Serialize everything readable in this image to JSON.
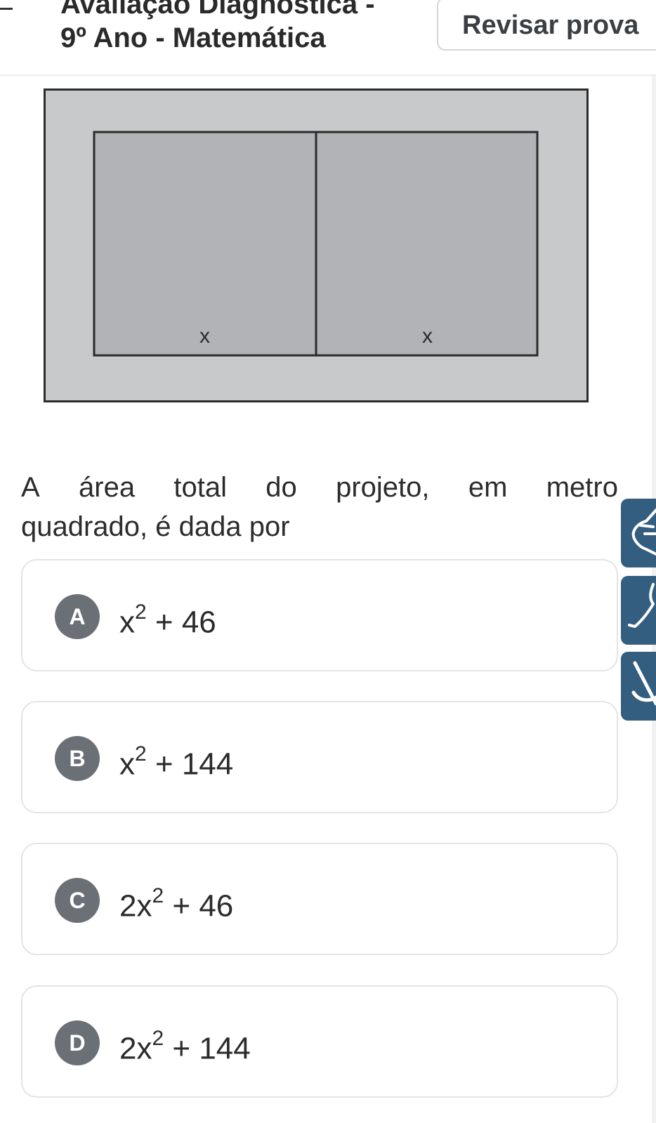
{
  "header": {
    "title_line1": "Avaliação Diagnóstica -",
    "title_line2": "9º Ano - Matemática",
    "review_label": "Revisar prova"
  },
  "figure": {
    "label_left": "x",
    "label_right": "x",
    "colors": {
      "outer": "#c8c9cb",
      "inner": "#b2b3b6",
      "stroke": "#2b2b2b"
    }
  },
  "question": {
    "line1_words": [
      "A",
      "área",
      "total",
      "do",
      "projeto,",
      "em",
      "metro"
    ],
    "line2": "quadrado, é dada por"
  },
  "options": [
    {
      "letter": "A",
      "coef": "",
      "var": "x",
      "exp": "2",
      "rest": " + 46"
    },
    {
      "letter": "B",
      "coef": "",
      "var": "x",
      "exp": "2",
      "rest": " + 144"
    },
    {
      "letter": "C",
      "coef": "2",
      "var": "x",
      "exp": "2",
      "rest": " + 46"
    },
    {
      "letter": "D",
      "coef": "2",
      "var": "x",
      "exp": "2",
      "rest": " + 144"
    }
  ],
  "side_tools": [
    {
      "icon": "hand-pointer-icon"
    },
    {
      "icon": "scissors-icon"
    },
    {
      "icon": "eye-slash-icon"
    }
  ],
  "colors": {
    "accent_tool": "#345e7f",
    "badge": "#6b7076"
  }
}
